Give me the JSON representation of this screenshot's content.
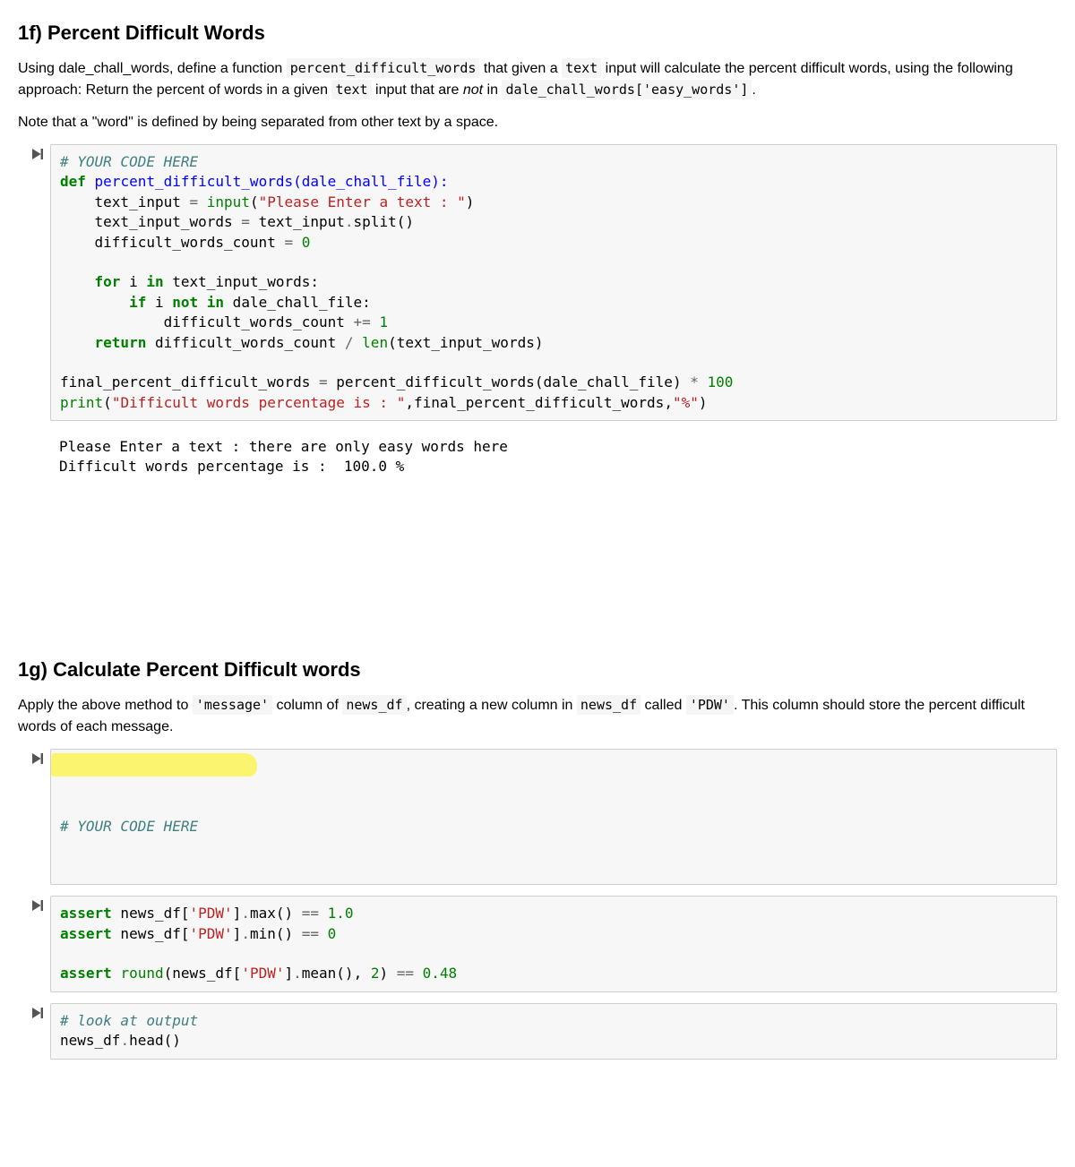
{
  "section1f": {
    "heading": "1f) Percent Difficult Words",
    "p1_a": "Using dale_chall_words, define a function ",
    "p1_code1": "percent_difficult_words",
    "p1_b": " that given a ",
    "p1_code2": "text",
    "p1_c": " input will calculate the percent difficult words, using the following approach: Return the percent of words in a given ",
    "p1_code3": "text",
    "p1_d": " input that are ",
    "p1_em": "not",
    "p1_e": " in ",
    "p1_code4": "dale_chall_words['easy_words']",
    "p1_f": ".",
    "p2": "Note that a \"word\" is defined by being separated from other text by a space."
  },
  "cell1": {
    "c1": "# YOUR CODE HERE",
    "l2_kw": "def",
    "l2_name": " percent_difficult_words(dale_chall_file):",
    "l3_a": "    text_input ",
    "l3_op": "=",
    "l3_b": " ",
    "l3_builtin": "input",
    "l3_c": "(",
    "l3_str": "\"Please Enter a text : \"",
    "l3_d": ")",
    "l4_a": "    text_input_words ",
    "l4_op": "=",
    "l4_b": " text_input",
    "l4_op2": ".",
    "l4_c": "split()",
    "l5_a": "    difficult_words_count ",
    "l5_op": "=",
    "l5_b": " ",
    "l5_num": "0",
    "l7_a": "    ",
    "l7_kw": "for",
    "l7_b": " i ",
    "l7_kw2": "in",
    "l7_c": " text_input_words:",
    "l8_a": "        ",
    "l8_kw": "if",
    "l8_b": " i ",
    "l8_kw2": "not",
    "l8_c": " ",
    "l8_kw3": "in",
    "l8_d": " dale_chall_file:",
    "l9_a": "            difficult_words_count ",
    "l9_op": "+=",
    "l9_b": " ",
    "l9_num": "1",
    "l10_a": "    ",
    "l10_kw": "return",
    "l10_b": " difficult_words_count ",
    "l10_op": "/",
    "l10_c": " ",
    "l10_builtin": "len",
    "l10_d": "(text_input_words)",
    "l12_a": "final_percent_difficult_words ",
    "l12_op": "=",
    "l12_b": " percent_difficult_words(dale_chall_file) ",
    "l12_op2": "*",
    "l12_c": " ",
    "l12_num": "100",
    "l13_builtin": "print",
    "l13_a": "(",
    "l13_str1": "\"Difficult words percentage is : \"",
    "l13_b": ",final_percent_difficult_words,",
    "l13_str2": "\"%\"",
    "l13_c": ")"
  },
  "output1": {
    "line1": "Please Enter a text : there are only easy words here",
    "line2": "Difficult words percentage is :  100.0 %"
  },
  "section1g": {
    "heading": "1g) Calculate Percent Difficult words",
    "p1_a": "Apply the above method to ",
    "p1_code1": "'message'",
    "p1_b": " column of ",
    "p1_code2": "news_df",
    "p1_c": ", creating a new column in ",
    "p1_code3": "news_df",
    "p1_d": " called ",
    "p1_code4": "'PDW'",
    "p1_e": ". This column should store the percent difficult words of each message."
  },
  "cell2": {
    "c1": "# YOUR CODE HERE"
  },
  "cell3": {
    "l1_kw": "assert",
    "l1_a": " news_df[",
    "l1_str": "'PDW'",
    "l1_b": "]",
    "l1_op": ".",
    "l1_c": "max() ",
    "l1_op2": "==",
    "l1_d": " ",
    "l1_num": "1.0",
    "l2_kw": "assert",
    "l2_a": " news_df[",
    "l2_str": "'PDW'",
    "l2_b": "]",
    "l2_op": ".",
    "l2_c": "min() ",
    "l2_op2": "==",
    "l2_d": " ",
    "l2_num": "0",
    "l4_kw": "assert",
    "l4_a": " ",
    "l4_builtin": "round",
    "l4_b": "(news_df[",
    "l4_str": "'PDW'",
    "l4_c": "]",
    "l4_op": ".",
    "l4_d": "mean(), ",
    "l4_num1": "2",
    "l4_e": ") ",
    "l4_op2": "==",
    "l4_f": " ",
    "l4_num2": "0.48"
  },
  "cell4": {
    "c1": "# look at output",
    "l2_a": "news_df",
    "l2_op": ".",
    "l2_b": "head()"
  }
}
